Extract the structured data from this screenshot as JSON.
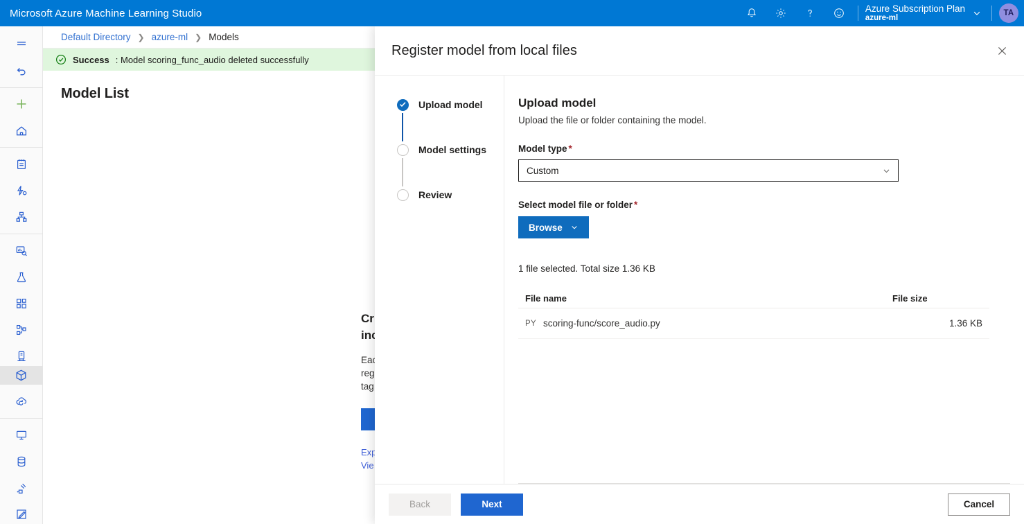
{
  "topbar": {
    "title": "Microsoft Azure Machine Learning Studio",
    "notifications_icon": "bell-icon",
    "settings_icon": "gear-icon",
    "help_icon": "question-mark-icon",
    "feedback_icon": "smiley-icon",
    "account_name": "Azure Subscription Plan",
    "account_directory": "azure-ml",
    "avatar_initials": "TA",
    "accent_color": "#0078d4"
  },
  "rail": {
    "items": [
      {
        "name": "menu-toggle",
        "icon": "hamburger-icon"
      },
      {
        "name": "back",
        "icon": "undo-arrow-icon"
      },
      {
        "name": "new",
        "icon": "plus-icon"
      },
      {
        "name": "home",
        "icon": "home-icon"
      },
      {
        "name": "notebooks",
        "icon": "notebook-icon"
      },
      {
        "name": "automated-ml",
        "icon": "automl-icon"
      },
      {
        "name": "designer",
        "icon": "sitemap-icon"
      },
      {
        "name": "jobs",
        "icon": "job-search-icon"
      },
      {
        "name": "components",
        "icon": "flask-icon"
      },
      {
        "name": "pipelines",
        "icon": "grid-blocks-icon"
      },
      {
        "name": "environments",
        "icon": "hierarchy-icon"
      },
      {
        "name": "endpoints",
        "icon": "server-icon"
      },
      {
        "name": "models",
        "icon": "cube-icon"
      },
      {
        "name": "deployments",
        "icon": "cloud-sync-icon"
      },
      {
        "name": "compute",
        "icon": "monitor-icon"
      },
      {
        "name": "datastores",
        "icon": "database-icon"
      },
      {
        "name": "linked-services",
        "icon": "plug-icon"
      },
      {
        "name": "labeling",
        "icon": "pencil-square-icon"
      }
    ],
    "selected": "models"
  },
  "page": {
    "breadcrumb": [
      "Default Directory",
      "azure-ml",
      "Models"
    ],
    "banner": {
      "icon": "success-check-icon",
      "label": "Success",
      "message": ": Model scoring_func_audio deleted successfully",
      "background": "#dff6dd"
    },
    "title": "Model List",
    "empty_state": {
      "heading_line1": "Cr",
      "heading_line2": "inc",
      "body_line1": "Eac",
      "body_line2": "reg",
      "body_line3": "tag",
      "link1": "Exp",
      "link2": "Vie"
    }
  },
  "panel": {
    "title": "Register model from local files",
    "close_icon": "close-icon",
    "steps": [
      {
        "label": "Upload model",
        "state": "done"
      },
      {
        "label": "Model settings",
        "state": "pending"
      },
      {
        "label": "Review",
        "state": "pending"
      }
    ],
    "content": {
      "heading": "Upload model",
      "subheading": "Upload the file or folder containing the model.",
      "model_type_label": "Model type",
      "model_type_value": "Custom",
      "select_file_label": "Select model file or folder",
      "browse_label": "Browse",
      "browse_chevron_icon": "chevron-down-icon",
      "selection_summary": "1 file selected. Total size 1.36 KB",
      "table": {
        "columns": [
          "File name",
          "File size"
        ],
        "rows": [
          {
            "type": "PY",
            "name": "scoring-func/score_audio.py",
            "size": "1.36 KB"
          }
        ]
      }
    },
    "footer": {
      "back_label": "Back",
      "next_label": "Next",
      "cancel_label": "Cancel"
    }
  }
}
